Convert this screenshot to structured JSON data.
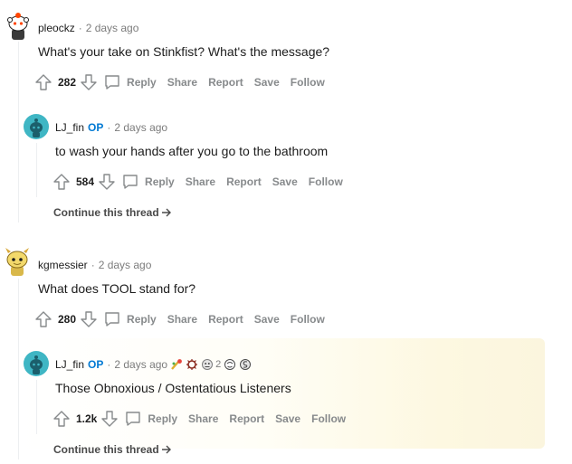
{
  "comments": [
    {
      "author": "pleockz",
      "time": "2 days ago",
      "body": "What's your take on Stinkfist? What's the message?",
      "score": "282",
      "actions": {
        "reply": "Reply",
        "share": "Share",
        "report": "Report",
        "save": "Save",
        "follow": "Follow"
      }
    },
    {
      "author": "LJ_fin",
      "op": "OP",
      "time": "2 days ago",
      "body": "to wash your hands after you go to the bathroom",
      "score": "584",
      "actions": {
        "reply": "Reply",
        "share": "Share",
        "report": "Report",
        "save": "Save",
        "follow": "Follow"
      },
      "continue": "Continue this thread"
    },
    {
      "author": "kgmessier",
      "time": "2 days ago",
      "body": "What does TOOL stand for?",
      "score": "280",
      "actions": {
        "reply": "Reply",
        "share": "Share",
        "report": "Report",
        "save": "Save",
        "follow": "Follow"
      }
    },
    {
      "author": "LJ_fin",
      "op": "OP",
      "time": "2 days ago",
      "body": "Those Obnoxious / Ostentatious Listeners",
      "score": "1.2k",
      "award_count": "2",
      "actions": {
        "reply": "Reply",
        "share": "Share",
        "report": "Report",
        "save": "Save",
        "follow": "Follow"
      },
      "continue": "Continue this thread"
    }
  ],
  "colors": {
    "op": "#0079d3",
    "meta": "#7c7c7c",
    "action": "#878a8c",
    "thread_line": "#edeff1",
    "avatar_lj_fin": "#3fb6c4"
  },
  "icons": [
    "upvote-icon",
    "downvote-icon",
    "reply-icon",
    "arrow-right-icon",
    "award-icon"
  ]
}
